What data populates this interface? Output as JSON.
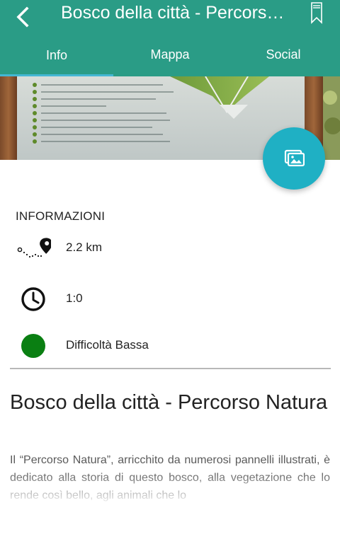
{
  "header": {
    "title": "Bosco della città - Percorso Natura",
    "back_icon": "back-arrow-icon",
    "bookmark_icon": "bookmark-icon",
    "color": "#2a9c86"
  },
  "tabs": [
    {
      "label": "Info",
      "active": true
    },
    {
      "label": "Mappa",
      "active": false
    },
    {
      "label": "Social",
      "active": false
    }
  ],
  "tab_indicator_color": "#44b7d3",
  "gallery_button": {
    "icon": "gallery-icon",
    "color": "#1fb0c4"
  },
  "info": {
    "heading": "INFORMAZIONI",
    "distance": {
      "icon": "route-pin-icon",
      "value": "2.2 km"
    },
    "duration": {
      "icon": "clock-icon",
      "value": "1:0"
    },
    "difficulty": {
      "icon": "difficulty-dot-icon",
      "value": "Difficoltà Bassa",
      "color": "#0a7f12"
    }
  },
  "route": {
    "title": "Bosco della città - Percorso Natura",
    "description": "Il “Percorso Natura”, arricchito da numerosi pannelli illustrati, è dedicato alla storia di questo bosco, alla vegetazione che lo rende così bello, agli animali che lo"
  }
}
